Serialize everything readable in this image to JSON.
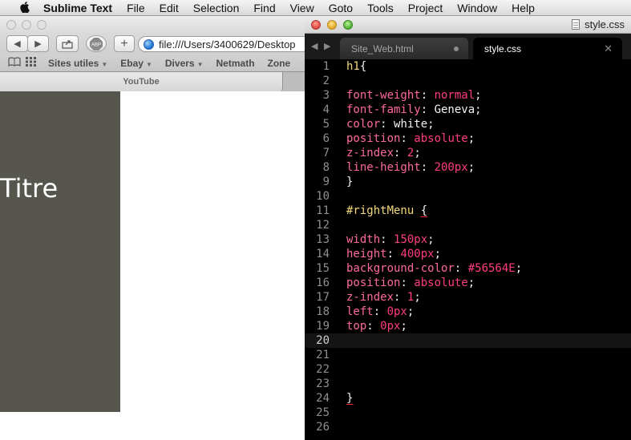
{
  "menubar": {
    "app_name": "Sublime Text",
    "items": [
      "File",
      "Edit",
      "Selection",
      "Find",
      "View",
      "Goto",
      "Tools",
      "Project",
      "Window",
      "Help"
    ]
  },
  "safari": {
    "address": "file:///Users/3400629/Desktop",
    "bookmarks": [
      "Sites utiles",
      "Ebay",
      "Divers",
      "Netmath",
      "Zone"
    ],
    "tab_title": "YouTube",
    "page": {
      "heading": "Titre",
      "menu_color": "#56564E"
    }
  },
  "sublime": {
    "window_title": "style.css",
    "tabs": [
      {
        "label": "Site_Web.html",
        "active": false,
        "dirty": true
      },
      {
        "label": "style.css",
        "active": true,
        "dirty": false
      }
    ],
    "current_line": 20,
    "lines": [
      {
        "n": "1",
        "tokens": [
          [
            "h1",
            "sel"
          ],
          [
            "{",
            "punct"
          ]
        ]
      },
      {
        "n": "2",
        "tokens": []
      },
      {
        "n": "3",
        "tokens": [
          [
            "font-weight",
            "prop"
          ],
          [
            ": ",
            "punct"
          ],
          [
            "normal",
            "val"
          ],
          [
            ";",
            "punct"
          ]
        ]
      },
      {
        "n": "4",
        "tokens": [
          [
            "font-family",
            "prop"
          ],
          [
            ": ",
            "punct"
          ],
          [
            "Geneva",
            "plain"
          ],
          [
            ";",
            "punct"
          ]
        ]
      },
      {
        "n": "5",
        "tokens": [
          [
            "color",
            "prop"
          ],
          [
            ": ",
            "punct"
          ],
          [
            "white",
            "plain"
          ],
          [
            ";",
            "punct"
          ]
        ]
      },
      {
        "n": "6",
        "tokens": [
          [
            "position",
            "prop"
          ],
          [
            ": ",
            "punct"
          ],
          [
            "absolute",
            "val"
          ],
          [
            ";",
            "punct"
          ]
        ]
      },
      {
        "n": "7",
        "tokens": [
          [
            "z-index",
            "prop"
          ],
          [
            ": ",
            "punct"
          ],
          [
            "2",
            "val"
          ],
          [
            ";",
            "punct"
          ]
        ]
      },
      {
        "n": "8",
        "tokens": [
          [
            "line-height",
            "prop"
          ],
          [
            ": ",
            "punct"
          ],
          [
            "200px",
            "val"
          ],
          [
            ";",
            "punct"
          ]
        ]
      },
      {
        "n": "9",
        "tokens": [
          [
            "}",
            "punct"
          ]
        ]
      },
      {
        "n": "10",
        "tokens": []
      },
      {
        "n": "11",
        "tokens": [
          [
            "#rightMenu",
            "sel"
          ],
          [
            " ",
            "punct"
          ],
          [
            "{",
            "brace-err"
          ]
        ]
      },
      {
        "n": "12",
        "tokens": []
      },
      {
        "n": "13",
        "tokens": [
          [
            "width",
            "prop"
          ],
          [
            ": ",
            "punct"
          ],
          [
            "150px",
            "val"
          ],
          [
            ";",
            "punct"
          ]
        ]
      },
      {
        "n": "14",
        "tokens": [
          [
            "height",
            "prop"
          ],
          [
            ": ",
            "punct"
          ],
          [
            "400px",
            "val"
          ],
          [
            ";",
            "punct"
          ]
        ]
      },
      {
        "n": "15",
        "tokens": [
          [
            "background-color",
            "prop"
          ],
          [
            ": ",
            "punct"
          ],
          [
            "#56564E",
            "val"
          ],
          [
            ";",
            "punct"
          ]
        ]
      },
      {
        "n": "16",
        "tokens": [
          [
            "position",
            "prop"
          ],
          [
            ": ",
            "punct"
          ],
          [
            "absolute",
            "val"
          ],
          [
            ";",
            "punct"
          ]
        ]
      },
      {
        "n": "17",
        "tokens": [
          [
            "z-index",
            "prop"
          ],
          [
            ": ",
            "punct"
          ],
          [
            "1",
            "val"
          ],
          [
            ";",
            "punct"
          ]
        ]
      },
      {
        "n": "18",
        "tokens": [
          [
            "left",
            "prop"
          ],
          [
            ": ",
            "punct"
          ],
          [
            "0px",
            "val"
          ],
          [
            ";",
            "punct"
          ]
        ]
      },
      {
        "n": "19",
        "tokens": [
          [
            "top",
            "prop"
          ],
          [
            ": ",
            "punct"
          ],
          [
            "0px",
            "val"
          ],
          [
            ";",
            "punct"
          ]
        ]
      },
      {
        "n": "20",
        "tokens": []
      },
      {
        "n": "21",
        "tokens": []
      },
      {
        "n": "22",
        "tokens": []
      },
      {
        "n": "23",
        "tokens": []
      },
      {
        "n": "24",
        "tokens": [
          [
            "}",
            "brace-err"
          ]
        ]
      },
      {
        "n": "25",
        "tokens": []
      },
      {
        "n": "26",
        "tokens": []
      }
    ]
  }
}
